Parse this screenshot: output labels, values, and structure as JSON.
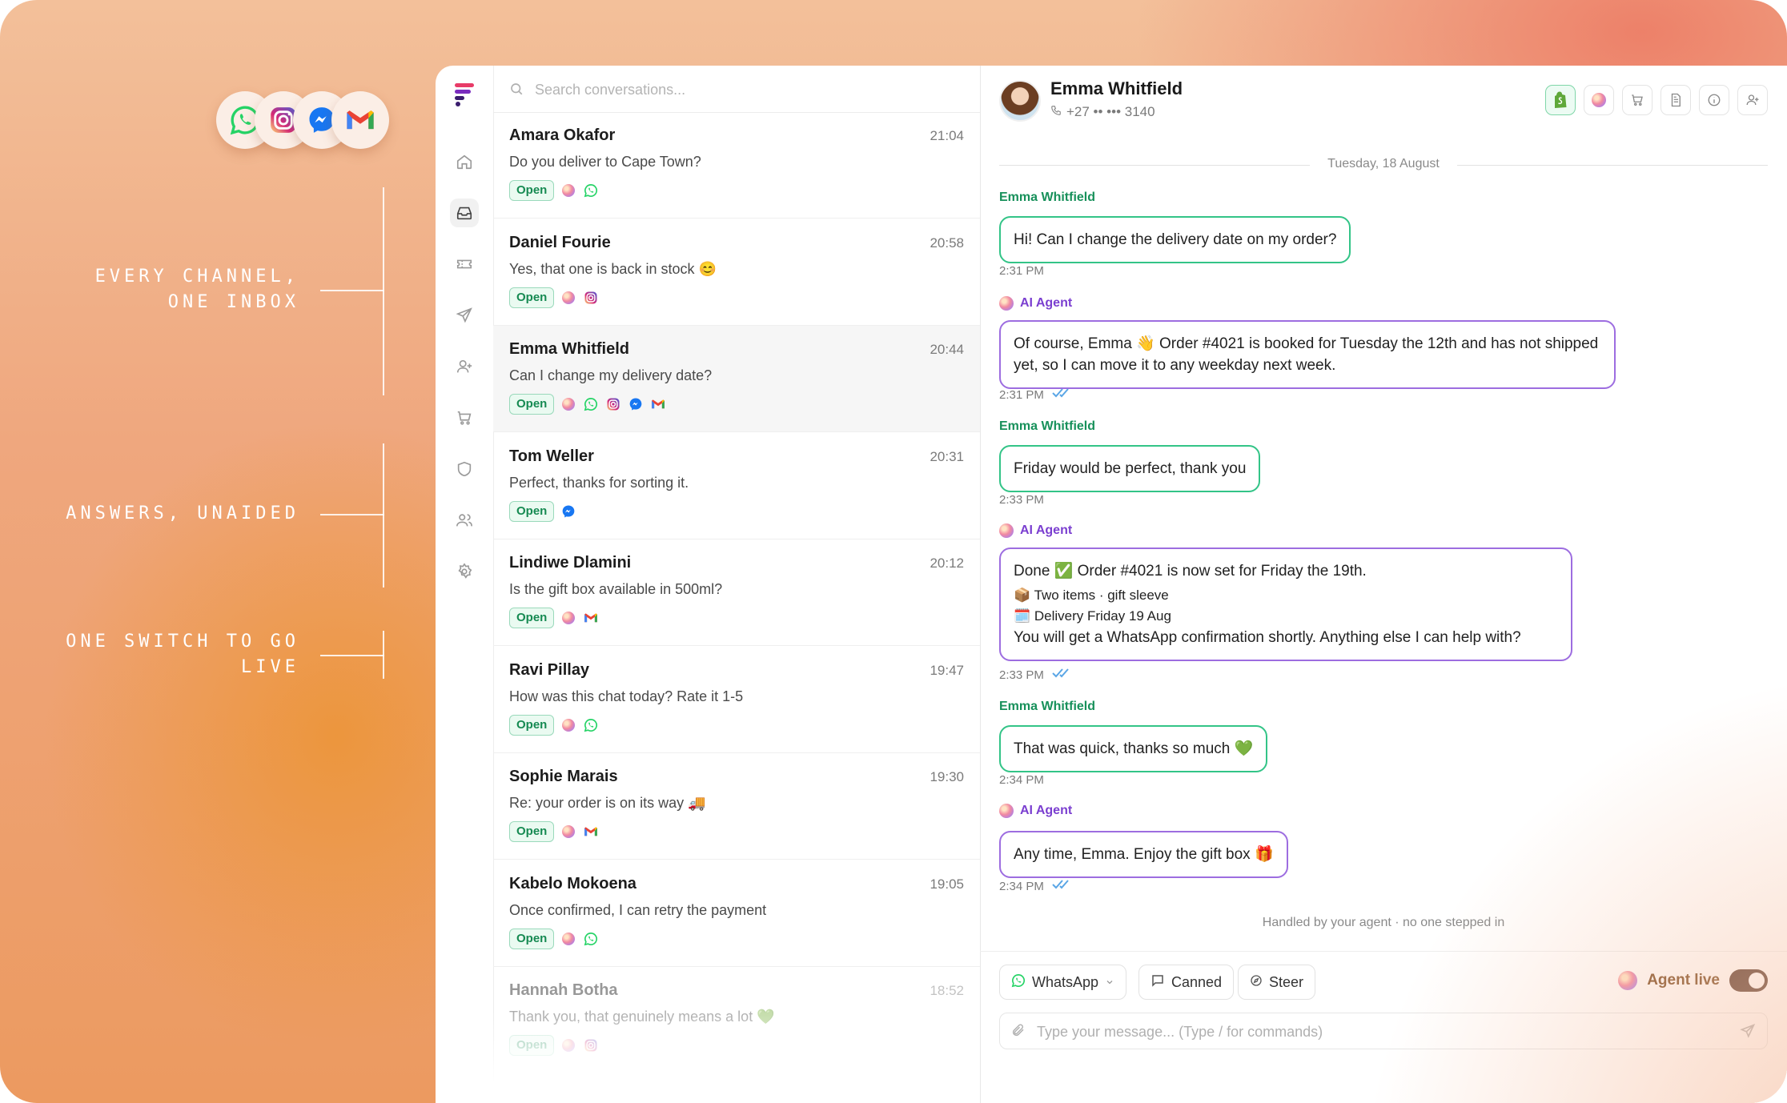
{
  "marketing": {
    "channel_icons": [
      "whatsapp-icon",
      "instagram-icon",
      "messenger-icon",
      "gmail-icon"
    ],
    "features": [
      "EVERY CHANNEL,\nONE INBOX",
      "ANSWERS, UNAIDED",
      "ONE SWITCH TO GO\nLIVE"
    ]
  },
  "sidebar": {
    "icons": [
      "app-logo-icon",
      "home-icon",
      "inbox-icon",
      "ticket-icon",
      "send-icon",
      "add-contact-icon",
      "cart-icon",
      "shield-icon",
      "team-icon",
      "settings-icon"
    ]
  },
  "search": {
    "placeholder": "Search conversations..."
  },
  "conversations": [
    {
      "name": "Amara Okafor",
      "time": "21:04",
      "snippet": "Do you deliver to Cape Town?",
      "status": "Open",
      "channels": [
        "ai",
        "whatsapp"
      ]
    },
    {
      "name": "Daniel Fourie",
      "time": "20:58",
      "snippet": "Yes, that one is back in stock 😊",
      "status": "Open",
      "channels": [
        "ai",
        "instagram"
      ]
    },
    {
      "name": "Emma Whitfield",
      "time": "20:44",
      "snippet": "Can I change my delivery date?",
      "status": "Open",
      "channels": [
        "ai",
        "whatsapp",
        "instagram",
        "messenger",
        "gmail"
      ]
    },
    {
      "name": "Tom Weller",
      "time": "20:31",
      "snippet": "Perfect, thanks for sorting it.",
      "status": "Open",
      "channels": [
        "messenger"
      ]
    },
    {
      "name": "Lindiwe Dlamini",
      "time": "20:12",
      "snippet": "Is the gift box available in 500ml?",
      "status": "Open",
      "channels": [
        "ai",
        "gmail"
      ]
    },
    {
      "name": "Ravi Pillay",
      "time": "19:47",
      "snippet": "How was this chat today? Rate it 1-5",
      "status": "Open",
      "channels": [
        "ai",
        "whatsapp"
      ]
    },
    {
      "name": "Sophie Marais",
      "time": "19:30",
      "snippet": "Re: your order is on its way 🚚",
      "status": "Open",
      "channels": [
        "ai",
        "gmail"
      ]
    },
    {
      "name": "Kabelo Mokoena",
      "time": "19:05",
      "snippet": "Once confirmed, I can retry the payment",
      "status": "Open",
      "channels": [
        "ai",
        "whatsapp"
      ]
    },
    {
      "name": "Hannah Botha",
      "time": "18:52",
      "snippet": "Thank you, that genuinely means a lot 💚",
      "status": "Open",
      "channels": [
        "ai",
        "instagram"
      ]
    }
  ],
  "chat": {
    "contact_name": "Emma Whitfield",
    "contact_phone": "+27 •• ••• 3140",
    "header_actions": [
      "shopify-icon",
      "ai-orb-icon",
      "cart-icon",
      "document-icon",
      "info-icon",
      "add-user-icon"
    ],
    "date_separator": "Tuesday, 18 August",
    "messages": [
      {
        "sender": "Emma Whitfield",
        "role": "customer",
        "text": "Hi! Can I change the delivery date on my order?",
        "time": "2:31 PM"
      },
      {
        "sender": "AI Agent",
        "role": "ai",
        "text": "Of course, Emma 👋 Order #4021 is booked for Tuesday the 12th and has not shipped yet, so I can move it to any weekday next week.",
        "time": "2:31 PM"
      },
      {
        "sender": "Emma Whitfield",
        "role": "customer",
        "text": "Friday would be perfect, thank you",
        "time": "2:33 PM"
      },
      {
        "sender": "AI Agent",
        "role": "ai",
        "line1": "Done ✅ Order #4021 is now set for Friday the 19th.",
        "line2": "📦 Two items · gift sleeve",
        "line3": "🗓️ Delivery Friday 19 Aug",
        "line4": "You will get a WhatsApp confirmation shortly. Anything else I can help with?",
        "time": "2:33 PM"
      },
      {
        "sender": "Emma Whitfield",
        "role": "customer",
        "text": "That was quick, thanks so much 💚",
        "time": "2:34 PM"
      },
      {
        "sender": "AI Agent",
        "role": "ai",
        "text": "Any time, Emma. Enjoy the gift box 🎁",
        "time": "2:34 PM"
      }
    ],
    "handled_note": "Handled by your agent · no one stepped in",
    "composer": {
      "channel_label": "WhatsApp",
      "canned_label": "Canned",
      "steer_label": "Steer",
      "agent_live_label": "Agent live",
      "agent_live_on": true,
      "placeholder": "Type your message... (Type / for commands)"
    }
  },
  "colors": {
    "customer_accent": "#33c487",
    "ai_accent": "#9d6de0",
    "open_badge": "#168a52"
  }
}
